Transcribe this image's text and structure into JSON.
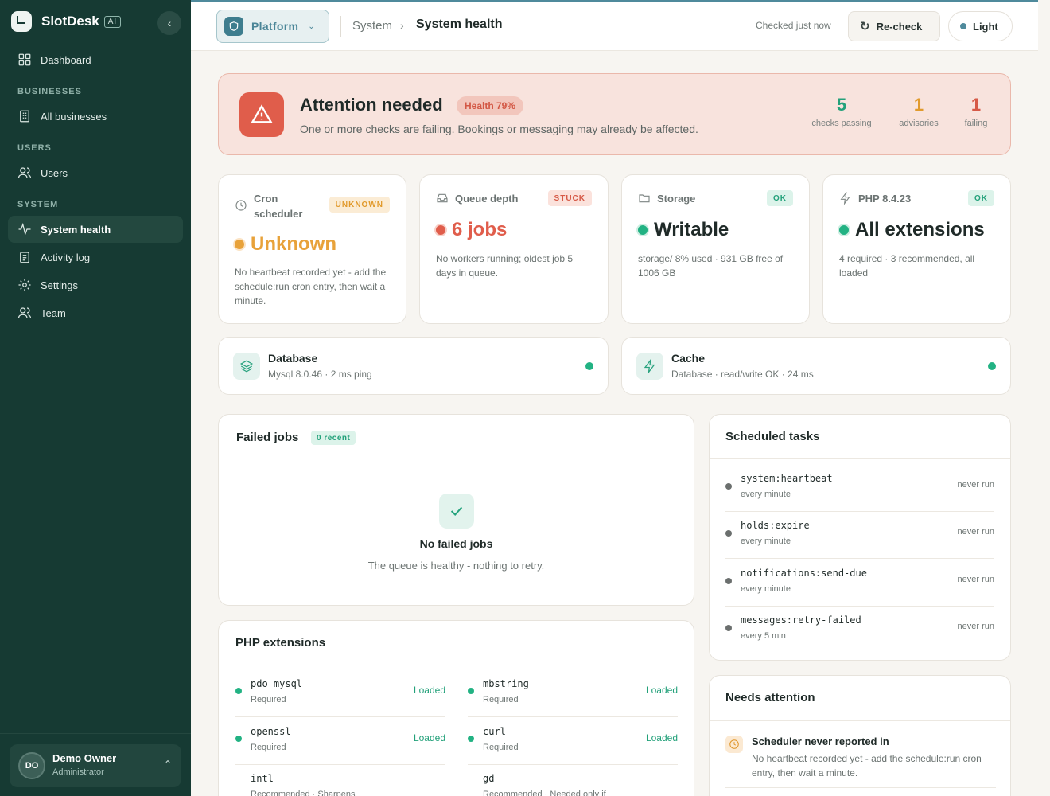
{
  "brand": {
    "name": "SlotDesk",
    "badge": "AI"
  },
  "sidebar": {
    "dashboard": "Dashboard",
    "sections": [
      "BUSINESSES",
      "USERS",
      "SYSTEM"
    ],
    "all_businesses": "All businesses",
    "users": "Users",
    "system_health": "System health",
    "activity_log": "Activity log",
    "settings": "Settings",
    "team": "Team"
  },
  "user": {
    "initials": "DO",
    "name": "Demo Owner",
    "role": "Administrator"
  },
  "header": {
    "platform": "Platform",
    "breadcrumb_parent": "System",
    "breadcrumb_current": "System health",
    "checked": "Checked just now",
    "recheck": "Re-check",
    "theme": "Light"
  },
  "alert": {
    "title": "Attention needed",
    "health": "Health 79%",
    "description": "One or more checks are failing. Bookings or messaging may already be affected.",
    "stats": [
      {
        "value": "5",
        "label": "checks passing",
        "color": "#23a17a"
      },
      {
        "value": "1",
        "label": "advisories",
        "color": "#e19a2c"
      },
      {
        "value": "1",
        "label": "failing",
        "color": "#d65a47"
      }
    ]
  },
  "cards": [
    {
      "label": "Cron scheduler",
      "badge": "UNKNOWN",
      "value": "Unknown",
      "desc": "No heartbeat recorded yet - add the schedule:run cron entry, then wait a minute.",
      "color": "#e8a23a"
    },
    {
      "label": "Queue depth",
      "badge": "STUCK",
      "value": "6 jobs",
      "desc": "No workers running; oldest job 5 days in queue.",
      "color": "#e05d4b"
    },
    {
      "label": "Storage",
      "badge": "OK",
      "value": "Writable",
      "desc": "storage/ 8% used · 931 GB free of 1006 GB",
      "color": "#1f2a28"
    },
    {
      "label": "PHP 8.4.23",
      "badge": "OK",
      "value": "All extensions",
      "desc": "4 required · 3 recommended, all loaded",
      "color": "#1f2a28"
    }
  ],
  "services": [
    {
      "name": "Database",
      "meta": "Mysql 8.0.46 · 2 ms ping"
    },
    {
      "name": "Cache",
      "meta": "Database · read/write OK · 24 ms"
    }
  ],
  "failed_jobs": {
    "title": "Failed jobs",
    "badge": "0 recent",
    "empty_title": "No failed jobs",
    "empty_sub": "The queue is healthy - nothing to retry."
  },
  "php_extensions": {
    "title": "PHP extensions",
    "items": [
      {
        "name": "pdo_mysql",
        "req": "Required",
        "status": "Loaded"
      },
      {
        "name": "mbstring",
        "req": "Required",
        "status": "Loaded"
      },
      {
        "name": "openssl",
        "req": "Required",
        "status": "Loaded"
      },
      {
        "name": "curl",
        "req": "Required",
        "status": "Loaded"
      },
      {
        "name": "intl",
        "req": "Recommended · Sharpens",
        "status": ""
      },
      {
        "name": "gd",
        "req": "Recommended · Needed only if",
        "status": ""
      }
    ]
  },
  "scheduled_tasks": {
    "title": "Scheduled tasks",
    "items": [
      {
        "name": "system:heartbeat",
        "freq": "every minute",
        "status": "never run"
      },
      {
        "name": "holds:expire",
        "freq": "every minute",
        "status": "never run"
      },
      {
        "name": "notifications:send-due",
        "freq": "every minute",
        "status": "never run"
      },
      {
        "name": "messages:retry-failed",
        "freq": "every 5 min",
        "status": "never run"
      }
    ]
  },
  "needs_attention": {
    "title": "Needs attention",
    "items": [
      {
        "title": "Scheduler never reported in",
        "desc": "No heartbeat recorded yet - add the schedule:run cron entry, then wait a minute."
      }
    ]
  }
}
